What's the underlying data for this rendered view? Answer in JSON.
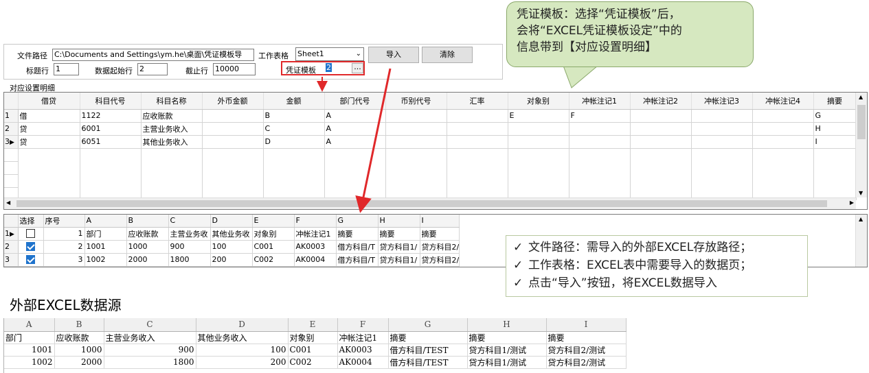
{
  "form": {
    "file_path_label": "文件路径",
    "file_path_value": "C:\\Documents and Settings\\ym.he\\桌面\\凭证模板导",
    "sheet_label": "工作表格",
    "sheet_value": "Sheet1",
    "import_button": "导入",
    "clear_button": "清除",
    "header_row_label": "标题行",
    "header_row_value": "1",
    "data_start_label": "数据起始行",
    "data_start_value": "2",
    "end_row_label": "截止行",
    "end_row_value": "10000",
    "template_label": "凭证模板",
    "template_value": "2",
    "template_browse": "..."
  },
  "mapping": {
    "group_title": "对应设置明细",
    "columns": [
      "借贷",
      "科目代号",
      "科目名称",
      "外币金额",
      "金额",
      "部门代号",
      "币别代号",
      "汇率",
      "对象别",
      "冲帐注记1",
      "冲帐注记2",
      "冲帐注记3",
      "冲帐注记4",
      "摘要"
    ],
    "rows": [
      {
        "no": "1",
        "marker": "",
        "cells": [
          "借",
          "1122",
          "应收账款",
          "",
          "B",
          "A",
          "",
          "",
          "E",
          "F",
          "",
          "",
          "",
          "G"
        ]
      },
      {
        "no": "2",
        "marker": "",
        "cells": [
          "贷",
          "6001",
          "主营业务收入",
          "",
          "C",
          "A",
          "",
          "",
          "",
          "",
          "",
          "",
          "",
          "H"
        ]
      },
      {
        "no": "3",
        "marker": "▶",
        "cells": [
          "贷",
          "6051",
          "其他业务收入",
          "",
          "D",
          "A",
          "",
          "",
          "",
          "",
          "",
          "",
          "",
          "I"
        ]
      }
    ]
  },
  "preview": {
    "columns": [
      "选择",
      "序号",
      "A",
      "B",
      "C",
      "D",
      "E",
      "F",
      "G",
      "H",
      "I"
    ],
    "rows": [
      {
        "no": "1",
        "marker": "▶",
        "checked": false,
        "cells": [
          "1",
          "部门",
          "应收账款",
          "主营业务收",
          "其他业务收",
          "对象别",
          "冲帐注记1",
          "摘要",
          "摘要",
          "摘要"
        ]
      },
      {
        "no": "2",
        "marker": "",
        "checked": true,
        "cells": [
          "2",
          "1001",
          "1000",
          "900",
          "100",
          "C001",
          "AK0003",
          "借方科目/T",
          "贷方科目1/",
          "贷方科目2/"
        ]
      },
      {
        "no": "3",
        "marker": "",
        "checked": true,
        "cells": [
          "3",
          "1002",
          "2000",
          "1800",
          "200",
          "C002",
          "AK0004",
          "借方科目/T",
          "贷方科目1/",
          "贷方科目2/"
        ]
      }
    ]
  },
  "excel": {
    "title": "外部EXCEL数据源",
    "columns": [
      "A",
      "B",
      "C",
      "D",
      "E",
      "F",
      "G",
      "H",
      "I"
    ],
    "rows": [
      [
        "部门",
        "应收账款",
        "主营业务收入",
        "其他业务收入",
        "对象别",
        "冲帐注记1",
        "摘要",
        "摘要",
        "摘要"
      ],
      [
        "1001",
        "1000",
        "900",
        "100",
        "C001",
        "AK0003",
        "借方科目/TEST",
        "贷方科目1/测试",
        "贷方科目2/测试"
      ],
      [
        "1002",
        "2000",
        "1800",
        "200",
        "C002",
        "AK0004",
        "借方科目/TEST",
        "贷方科目1/测试",
        "贷方科目2/测试"
      ]
    ]
  },
  "callout_template": {
    "line1": "凭证模板：选择“凭证模板”后，",
    "line2": "会将“EXCEL凭证模板设定”中的",
    "line3": "信息带到【对应设置明细】"
  },
  "callout_notes": {
    "check_icon": "✓",
    "line1": "文件路径：需导入的外部EXCEL存放路径；",
    "line2": "工作表格：EXCEL表中需要导入的数据页；",
    "line3": "点击“导入”按钮，将EXCEL数据导入"
  },
  "colors": {
    "highlight_red": "#e0282a",
    "bubble_fill": "#d6e8c0",
    "check_blue": "#1f73cc"
  }
}
